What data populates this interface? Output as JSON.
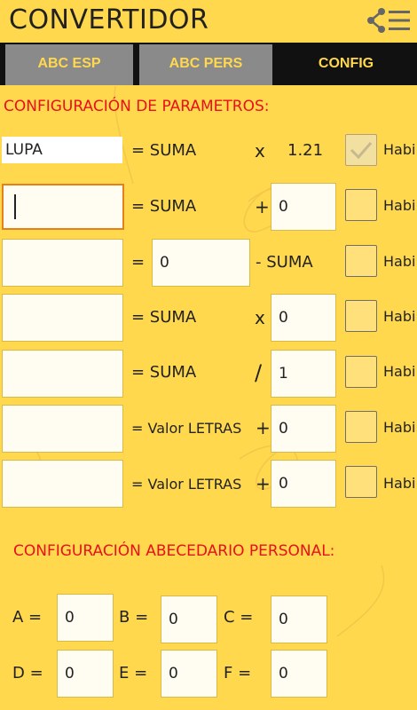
{
  "header": {
    "title": "CONVERTIDOR",
    "share_icon": "share-menu-icon"
  },
  "tabs": [
    {
      "label": "ABC ESP",
      "active": false
    },
    {
      "label": "ABC PERS",
      "active": false
    },
    {
      "label": "CONFIG",
      "active": true
    }
  ],
  "params_section": {
    "title": "CONFIGURACIÓN DE PARAMETROS:",
    "rows": [
      {
        "name_value": "LUPA",
        "eq": "= SUMA",
        "op": "x",
        "operand": "1.21",
        "checked": true,
        "check_label": "Habi"
      },
      {
        "name_value": "",
        "eq": "= SUMA",
        "op": "+",
        "operand": "0",
        "checked": false,
        "check_label": "Habi"
      },
      {
        "name_value": "",
        "eq": "=",
        "middle_value": "0",
        "op": "- SUMA",
        "checked": false,
        "check_label": "Habi"
      },
      {
        "name_value": "",
        "eq": "= SUMA",
        "op": "x",
        "operand": "0",
        "checked": false,
        "check_label": "Habi"
      },
      {
        "name_value": "",
        "eq": "= SUMA",
        "op": "/",
        "operand": "1",
        "checked": false,
        "check_label": "Habi"
      },
      {
        "name_value": "",
        "eq": "= Valor LETRAS",
        "op": "+",
        "operand": "0",
        "checked": false,
        "check_label": "Habi"
      },
      {
        "name_value": "",
        "eq": "= Valor LETRAS",
        "op": "+",
        "operand": "0",
        "checked": false,
        "check_label": "Habi"
      }
    ]
  },
  "alphabet_section": {
    "title": "CONFIGURACIÓN ABECEDARIO PERSONAL:",
    "letters": [
      {
        "label": "A =",
        "value": "0"
      },
      {
        "label": "B =",
        "value": "0"
      },
      {
        "label": "C =",
        "value": "0"
      },
      {
        "label": "D =",
        "value": "0"
      },
      {
        "label": "E =",
        "value": "0"
      },
      {
        "label": "F =",
        "value": "0"
      }
    ]
  },
  "colors": {
    "background": "#ffd84e",
    "tab_bar": "#111111",
    "tab_inactive": "#8a8a8a",
    "accent_text": "#e8101a"
  }
}
